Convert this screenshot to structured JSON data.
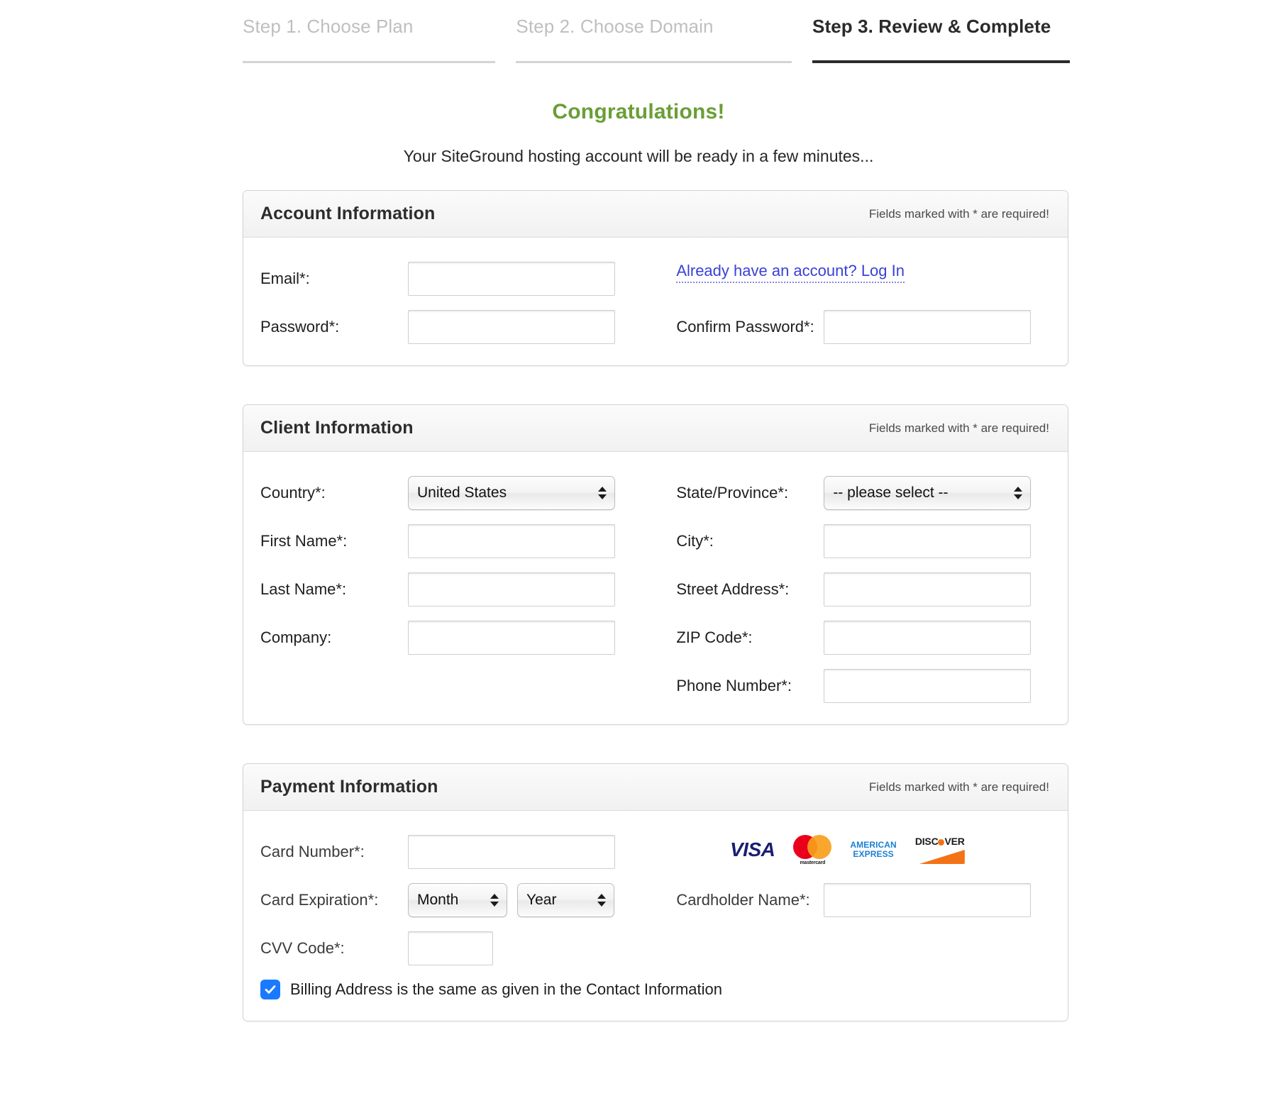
{
  "steps": [
    {
      "label": "Step 1. Choose Plan",
      "active": false
    },
    {
      "label": "Step 2. Choose Domain",
      "active": false
    },
    {
      "label": "Step 3. Review & Complete",
      "active": true
    }
  ],
  "headline": "Congratulations!",
  "subtitle": "Your SiteGround hosting account will be ready in a few minutes...",
  "colors": {
    "headline_green": "#6a9e36",
    "link_blue": "#3a41d6",
    "checkbox_blue": "#1a7aff",
    "active_step": "#2a2a2a",
    "inactive_step": "#bfbfbf"
  },
  "required_note": "Fields marked with * are required!",
  "account": {
    "title": "Account Information",
    "email_label": "Email*:",
    "email_value": "",
    "password_label": "Password*:",
    "password_value": "",
    "confirm_password_label": "Confirm Password*:",
    "confirm_password_value": "",
    "login_link": "Already have an account? Log In"
  },
  "client": {
    "title": "Client Information",
    "country_label": "Country*:",
    "country_value": "United States",
    "state_label": "State/Province*:",
    "state_value": "-- please select --",
    "first_name_label": "First Name*:",
    "first_name_value": "",
    "city_label": "City*:",
    "city_value": "",
    "last_name_label": "Last Name*:",
    "last_name_value": "",
    "street_label": "Street Address*:",
    "street_value": "",
    "company_label": "Company:",
    "company_value": "",
    "zip_label": "ZIP Code*:",
    "zip_value": "",
    "phone_label": "Phone Number*:",
    "phone_value": ""
  },
  "payment": {
    "title": "Payment Information",
    "card_number_label": "Card Number*:",
    "card_number_value": "",
    "card_expiration_label": "Card Expiration*:",
    "month_value": "Month",
    "year_value": "Year",
    "cardholder_label": "Cardholder Name*:",
    "cardholder_value": "",
    "cvv_label": "CVV Code*:",
    "cvv_value": "",
    "billing_checkbox_label": "Billing Address is the same as given in the Contact Information",
    "billing_checked": true,
    "card_logos": [
      {
        "name": "visa",
        "text": "VISA"
      },
      {
        "name": "mastercard",
        "text": "mastercard"
      },
      {
        "name": "american-express",
        "line1": "AMERICAN",
        "line2": "EXPRESS"
      },
      {
        "name": "discover",
        "pre": "DISC",
        "post": "VER"
      }
    ]
  }
}
